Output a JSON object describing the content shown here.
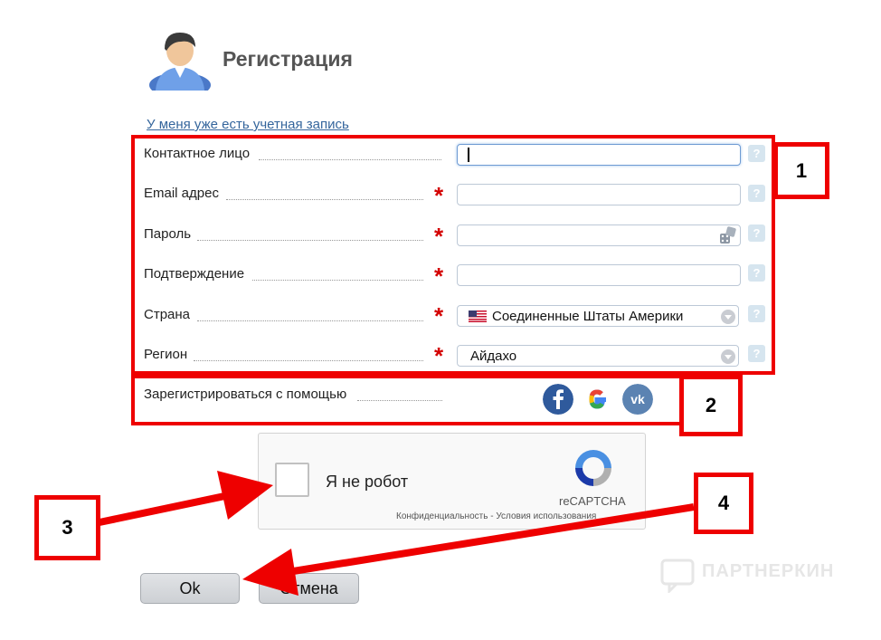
{
  "header": {
    "title": "Регистрация",
    "login_link": "У меня уже есть учетная запись"
  },
  "form": {
    "rows": [
      {
        "label": "Контактное лицо",
        "required": false,
        "value": "",
        "type": "text"
      },
      {
        "label": "Email адрес",
        "required": true,
        "value": "",
        "type": "text"
      },
      {
        "label": "Пароль",
        "required": true,
        "value": "",
        "type": "password"
      },
      {
        "label": "Подтверждение",
        "required": true,
        "value": "",
        "type": "password"
      },
      {
        "label": "Страна",
        "required": true,
        "value": "Соединенные Штаты Америки",
        "type": "select"
      },
      {
        "label": "Регион",
        "required": true,
        "value": "Айдахо",
        "type": "select"
      }
    ],
    "required_mark": "*",
    "help_mark": "?"
  },
  "social": {
    "label": "Зарегистрироваться с помощью",
    "providers": [
      "facebook",
      "google",
      "vk"
    ]
  },
  "recaptcha": {
    "label": "Я не робот",
    "brand": "reCAPTCHA",
    "links": "Конфиденциальность - Условия использования"
  },
  "buttons": {
    "ok": "Ok",
    "cancel": "Отмена"
  },
  "annotations": [
    "1",
    "2",
    "3",
    "4"
  ],
  "watermark": "ПАРТНЕРКИН",
  "colors": {
    "annotation_red": "#ee0000",
    "required_red": "#d40000",
    "link": "#34659c"
  }
}
